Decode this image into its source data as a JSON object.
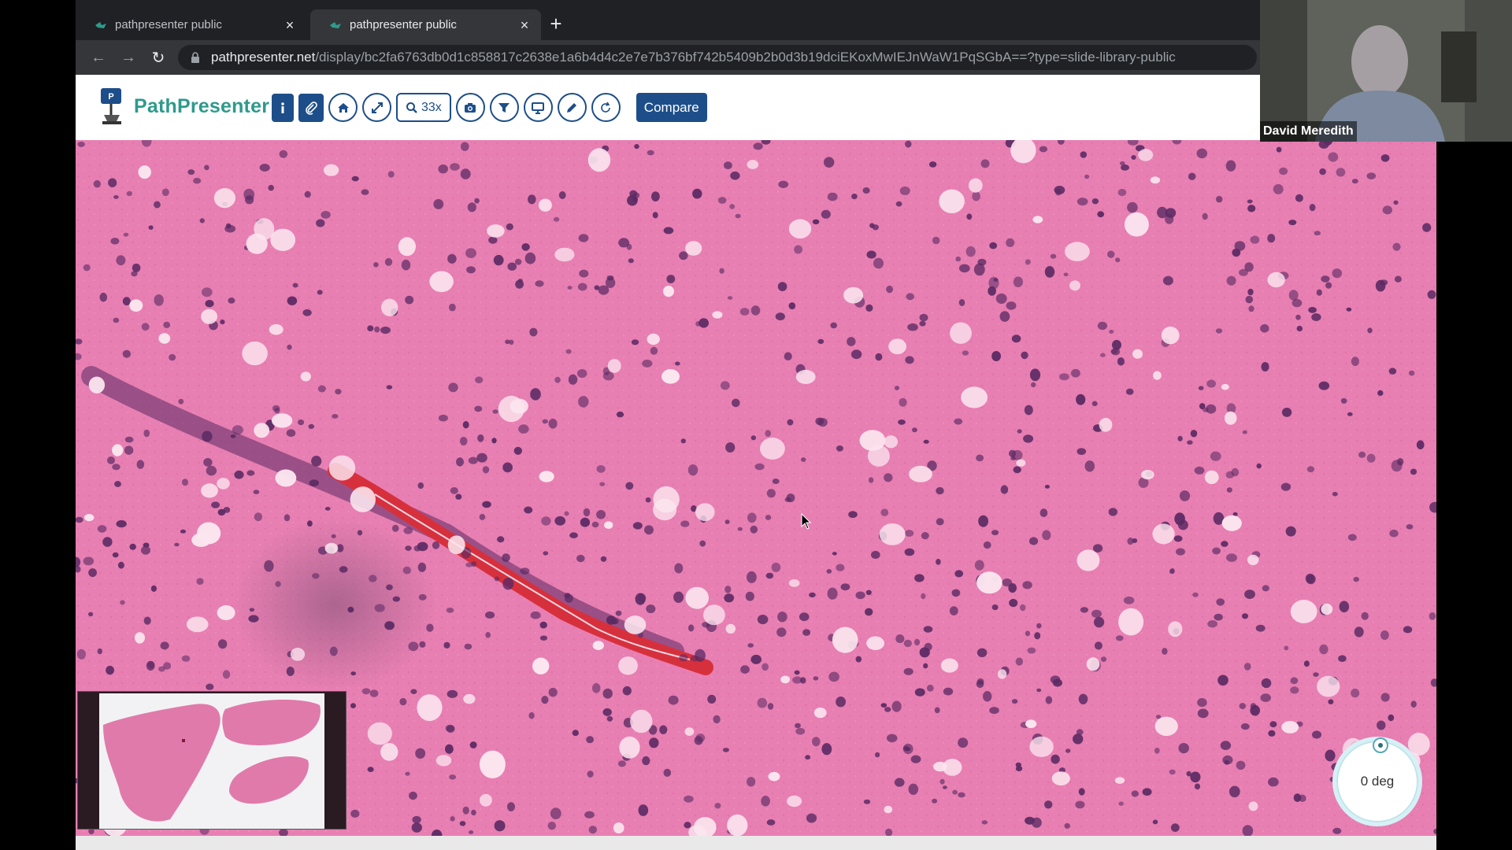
{
  "browser": {
    "tabs": [
      {
        "title": "pathpresenter public",
        "active": false
      },
      {
        "title": "pathpresenter public",
        "active": true
      }
    ],
    "url_host": "pathpresenter.net",
    "url_path": "/display/bc2fa6763db0d1c858817c2638e1a6b4d4c2e7e7b376bf742b5409b2b0d3b19dciEKoxMwIEJnWaW1PqSGbA==?type=slide-library-public"
  },
  "app": {
    "brand": "PathPresenter",
    "brand_color": "#2d9a8c",
    "accent_color": "#1d4e89",
    "toolbar": {
      "tools": [
        "info-icon",
        "paperclip-icon",
        "home-icon",
        "expand-icon",
        "zoom-icon",
        "camera-icon",
        "filter-icon",
        "monitor-icon",
        "pencil-icon",
        "rotate-icon"
      ],
      "zoom_label": "33x",
      "compare_label": "Compare"
    }
  },
  "viewer": {
    "stain_colors": {
      "background": "#e77fb2",
      "nuclei": "#5b2a63",
      "rbc": "#d7303d",
      "vacuole": "#fbe6ef"
    },
    "rotation_label": "0 deg"
  },
  "webcam": {
    "participant_name": "David Meredith"
  }
}
